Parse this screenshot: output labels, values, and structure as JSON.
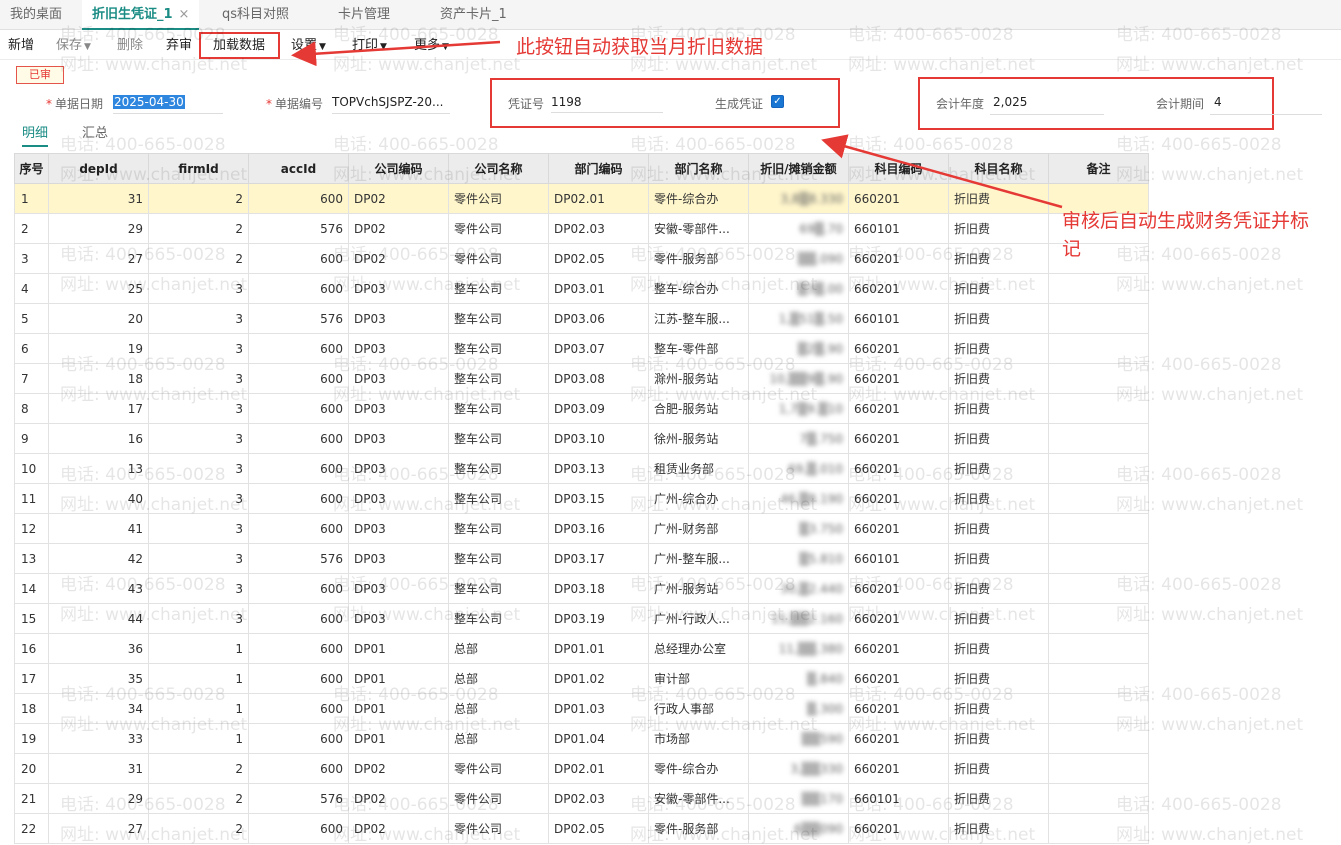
{
  "tabs": [
    {
      "label": "我的桌面",
      "active": false
    },
    {
      "label": "折旧生凭证_1",
      "active": true
    },
    {
      "label": "qs科目对照",
      "active": false
    },
    {
      "label": "卡片管理",
      "active": false
    },
    {
      "label": "资产卡片_1",
      "active": false
    }
  ],
  "tab_close": "×",
  "toolbar": {
    "new": "新增",
    "save": "保存",
    "delete": "删除",
    "abandon": "弃审",
    "load_data": "加载数据",
    "settings": "设置",
    "print": "打印",
    "more": "更多"
  },
  "status_badge": "已审",
  "form": {
    "doc_date_label": "单据日期",
    "doc_date_value": "2025-04-30",
    "doc_no_label": "单据编号",
    "doc_no_value": "TOPVchSJSPZ-20...",
    "voucher_no_label": "凭证号",
    "voucher_no_value": "1198",
    "gen_voucher_label": "生成凭证",
    "gen_voucher_checked": true,
    "fiscal_year_label": "会计年度",
    "fiscal_year_value": "2,025",
    "fiscal_period_label": "会计期间",
    "fiscal_period_value": "4"
  },
  "subtabs": [
    "明细",
    "汇总"
  ],
  "annotations": {
    "load_button_note": "此按钮自动获取当月折旧数据",
    "voucher_note_line1": "审核后自动生成财务凭证并标",
    "voucher_note_line2": "记"
  },
  "watermark": {
    "phone": "电话: 400-665-0028",
    "site": "网址: www.chanjet.net"
  },
  "accent_color": "#1a8c84",
  "annotation_color": "#e53935",
  "table": {
    "columns": [
      "序号",
      "depId",
      "firmId",
      "accId",
      "公司编码",
      "公司名称",
      "部门编码",
      "部门名称",
      "折旧/摊销金额",
      "科目编码",
      "科目名称",
      "备注"
    ],
    "rows": [
      [
        "1",
        "31",
        "2",
        "600",
        "DP02",
        "零件公司",
        "DP02.01",
        "零件-综合办",
        "3,8▒8.330",
        "660201",
        "折旧费",
        ""
      ],
      [
        "2",
        "29",
        "2",
        "576",
        "DP02",
        "零件公司",
        "DP02.03",
        "安徽-零部件...",
        "69▒.70",
        "660101",
        "折旧费",
        ""
      ],
      [
        "3",
        "27",
        "2",
        "600",
        "DP02",
        "零件公司",
        "DP02.05",
        "零件-服务部",
        "▒▒.090",
        "660201",
        "折旧费",
        ""
      ],
      [
        "4",
        "25",
        "3",
        "600",
        "DP03",
        "整车公司",
        "DP03.01",
        "整车-综合办",
        "▒3▒.00",
        "660201",
        "折旧费",
        ""
      ],
      [
        "5",
        "20",
        "3",
        "576",
        "DP03",
        "整车公司",
        "DP03.06",
        "江苏-整车服...",
        "1,▒51▒.50",
        "660101",
        "折旧费",
        ""
      ],
      [
        "6",
        "19",
        "3",
        "600",
        "DP03",
        "整车公司",
        "DP03.07",
        "整车-零件部",
        "▒2▒.90",
        "660201",
        "折旧费",
        ""
      ],
      [
        "7",
        "18",
        "3",
        "600",
        "DP03",
        "整车公司",
        "DP03.08",
        "滁州-服务站",
        "10,▒▒9▒.90",
        "660201",
        "折旧费",
        ""
      ],
      [
        "8",
        "17",
        "3",
        "600",
        "DP03",
        "整车公司",
        "DP03.09",
        "合肥-服务站",
        "1,7▒9.▒10",
        "660201",
        "折旧费",
        ""
      ],
      [
        "9",
        "16",
        "3",
        "600",
        "DP03",
        "整车公司",
        "DP03.10",
        "徐州-服务站",
        "7▒.750",
        "660201",
        "折旧费",
        ""
      ],
      [
        "10",
        "13",
        "3",
        "600",
        "DP03",
        "整车公司",
        "DP03.13",
        "租赁业务部",
        "69,▒.010",
        "660201",
        "折旧费",
        ""
      ],
      [
        "11",
        "40",
        "3",
        "600",
        "DP03",
        "整车公司",
        "DP03.15",
        "广州-综合办",
        "46,▒8.190",
        "660201",
        "折旧费",
        ""
      ],
      [
        "12",
        "41",
        "3",
        "600",
        "DP03",
        "整车公司",
        "DP03.16",
        "广州-财务部",
        "▒3.750",
        "660201",
        "折旧费",
        ""
      ],
      [
        "13",
        "42",
        "3",
        "576",
        "DP03",
        "整车公司",
        "DP03.17",
        "广州-整车服...",
        "▒5.810",
        "660101",
        "折旧费",
        ""
      ],
      [
        "14",
        "43",
        "3",
        "600",
        "DP03",
        "整车公司",
        "DP03.18",
        "广州-服务站",
        "30,▒2.440",
        "660201",
        "折旧费",
        ""
      ],
      [
        "15",
        "44",
        "3",
        "600",
        "DP03",
        "整车公司",
        "DP03.19",
        "广州-行政人...",
        "15,▒▒2.160",
        "660201",
        "折旧费",
        ""
      ],
      [
        "16",
        "36",
        "1",
        "600",
        "DP01",
        "总部",
        "DP01.01",
        "总经理办公室",
        "11,▒▒.380",
        "660201",
        "折旧费",
        ""
      ],
      [
        "17",
        "35",
        "1",
        "600",
        "DP01",
        "总部",
        "DP01.02",
        "审计部",
        "▒.840",
        "660201",
        "折旧费",
        ""
      ],
      [
        "18",
        "34",
        "1",
        "600",
        "DP01",
        "总部",
        "DP01.03",
        "行政人事部",
        "▒.300",
        "660201",
        "折旧费",
        ""
      ],
      [
        "19",
        "33",
        "1",
        "600",
        "DP01",
        "总部",
        "DP01.04",
        "市场部",
        "▒▒590",
        "660201",
        "折旧费",
        ""
      ],
      [
        "20",
        "31",
        "2",
        "600",
        "DP02",
        "零件公司",
        "DP02.01",
        "零件-综合办",
        "3,▒▒330",
        "660201",
        "折旧费",
        ""
      ],
      [
        "21",
        "29",
        "2",
        "576",
        "DP02",
        "零件公司",
        "DP02.03",
        "安徽-零部件...",
        "▒▒170",
        "660101",
        "折旧费",
        ""
      ],
      [
        "22",
        "27",
        "2",
        "600",
        "DP02",
        "零件公司",
        "DP02.05",
        "零件-服务部",
        "6▒▒090",
        "660201",
        "折旧费",
        ""
      ]
    ]
  }
}
